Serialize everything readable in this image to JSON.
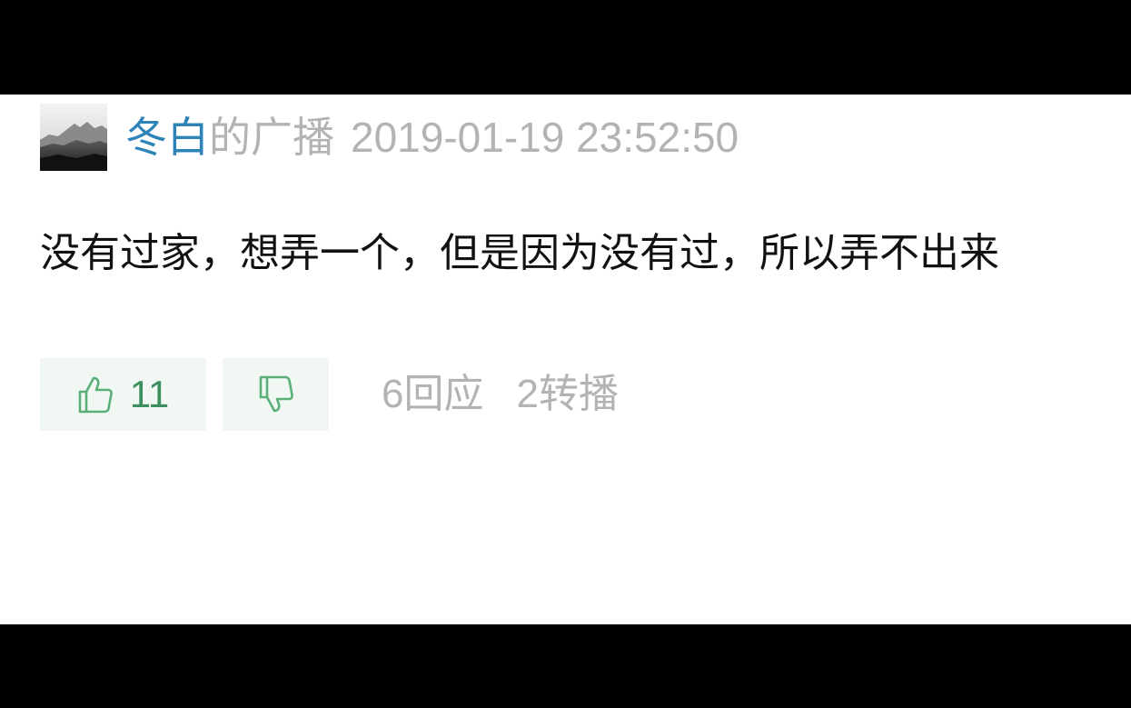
{
  "post": {
    "username": "冬白",
    "post_type": "的广播",
    "timestamp": "2019-01-19 23:52:50",
    "content": "没有过家，想弄一个，但是因为没有过，所以弄不出来",
    "avatar_icon": "landscape-avatar"
  },
  "actions": {
    "like_icon": "thumbs-up-icon",
    "like_count": "11",
    "dislike_icon": "thumbs-down-icon",
    "replies_count": "6",
    "replies_label": "回应",
    "reposts_count": "2",
    "reposts_label": "转播"
  },
  "colors": {
    "username": "#2e84b8",
    "meta": "#b3b3b3",
    "content": "#111111",
    "button_bg": "#f1f8f3",
    "button_icon": "#5bb07a",
    "like_count": "#3a8f5c",
    "letterbox": "#000000"
  }
}
